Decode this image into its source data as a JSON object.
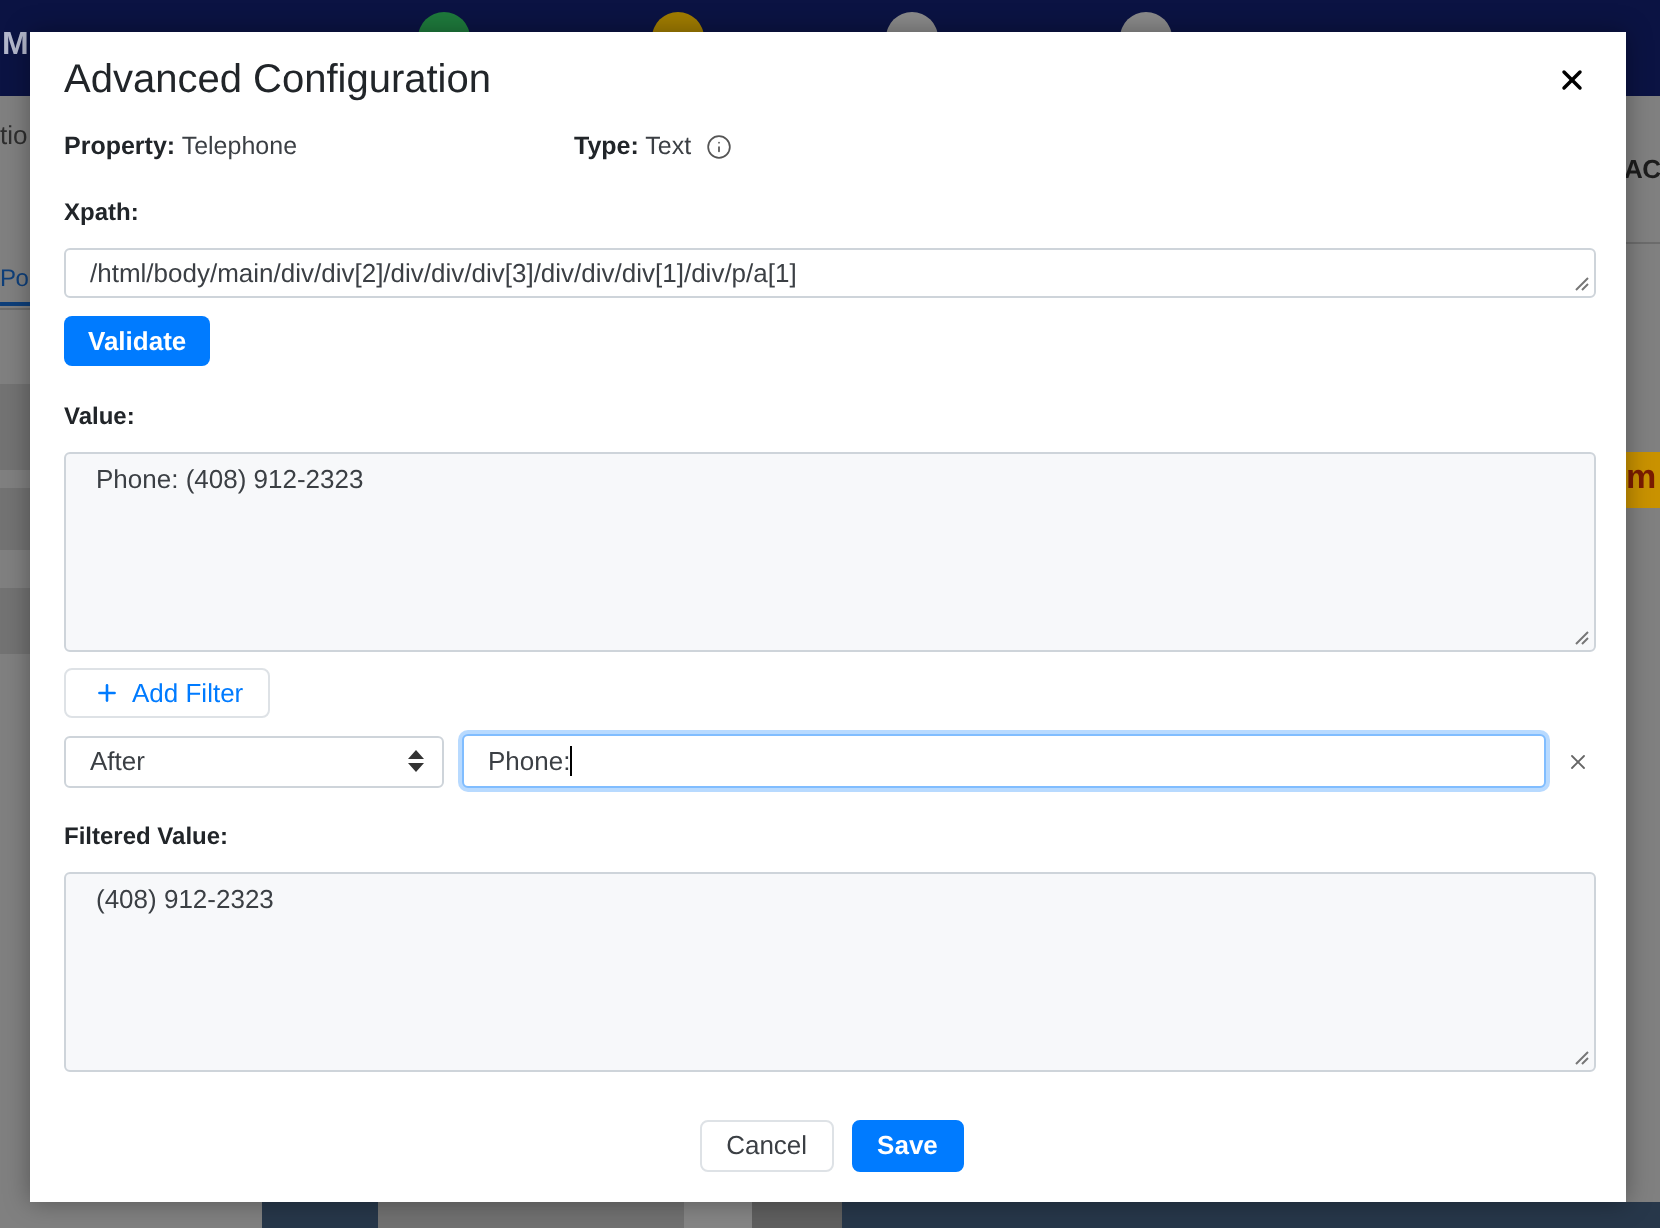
{
  "background": {
    "header": {
      "title": "M",
      "steps": [
        {
          "color": "#1e7a3c"
        },
        {
          "color": "#a07c00"
        },
        {
          "color": "#8a8a8a"
        },
        {
          "color": "#8a8a8a"
        }
      ]
    },
    "left_text": "tio",
    "tab": {
      "label": "Po",
      "selected": true
    },
    "right_text": "AC",
    "badge": "m"
  },
  "dialog": {
    "title": "Advanced Configuration",
    "property": {
      "label": "Property:",
      "value": "Telephone"
    },
    "type": {
      "label": "Type:",
      "value": "Text"
    },
    "xpath": {
      "label": "Xpath:",
      "value": "/html/body/main/div/div[2]/div/div/div[3]/div/div/div[1]/div/p/a[1]"
    },
    "validate_button": "Validate",
    "value": {
      "label": "Value:",
      "value": "Phone: (408) 912-2323"
    },
    "add_filter_button": "Add Filter",
    "filters": [
      {
        "operator": "After",
        "value": "Phone:",
        "focused": true
      }
    ],
    "filtered_value": {
      "label": "Filtered Value:",
      "value": "(408) 912-2323"
    },
    "buttons": [
      {
        "label": "Cancel",
        "kind": "secondary"
      },
      {
        "label": "Save",
        "kind": "primary"
      }
    ]
  }
}
